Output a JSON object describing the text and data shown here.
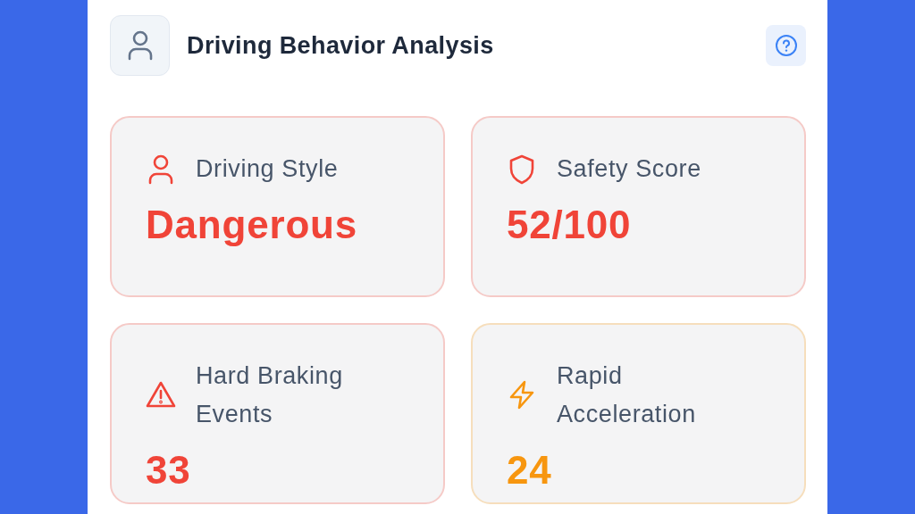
{
  "header": {
    "title": "Driving Behavior Analysis"
  },
  "cards": [
    {
      "kind": "style",
      "label": "Driving Style",
      "value": "Dangerous",
      "color": "#f04438"
    },
    {
      "kind": "score",
      "label": "Safety Score",
      "value": "52/100",
      "color": "#f04438"
    },
    {
      "kind": "braking",
      "label": "Hard Braking Events",
      "value": "33",
      "color": "#f04438"
    },
    {
      "kind": "acceleration",
      "label": "Rapid Acceleration",
      "value": "24",
      "color": "#f7960f"
    }
  ]
}
